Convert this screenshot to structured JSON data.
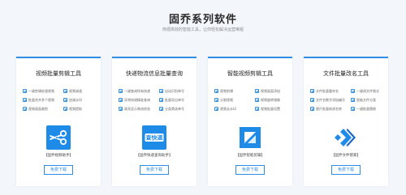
{
  "header": {
    "title": "固乔系列软件",
    "subtitle": "简便高效的智能工具，让你轻松解决运营难题"
  },
  "cards": [
    {
      "title": "视频批量剪辑工具",
      "features": [
        "一键剪辑处理视频",
        "视频调速",
        "批量合并多个视频",
        "加减水印",
        "视频画面裁剪",
        "视频提取"
      ],
      "caption": "【固乔视频助手】",
      "button": "免费下载",
      "icon": "scissors-icon"
    },
    {
      "title": "快递物流信息批量查询",
      "features": [
        "一键查询所有快递",
        "自动识别单号",
        "异常快递精准查询",
        "批量导出单号",
        "高亮显示物流状态",
        "分类筛选单号"
      ],
      "caption": "【固乔快递查询助手】",
      "button": "免费下载",
      "icon": "express-query-icon"
    },
    {
      "title": "智能视频剪辑工具",
      "features": [
        "视频剪辑",
        "视频画面添加",
        "分割视频",
        "视频旋转镜像",
        "视频去水印",
        "视频批量设置"
      ],
      "caption": "【固乔智能剪辑】",
      "button": "免费下载",
      "icon": "smart-edit-icon"
    },
    {
      "title": "文件批量改名工具",
      "features": [
        "文件批量重命名",
        "一键改文件格式",
        "文件名数字添加编号",
        "智能文件分类",
        "图片批量修改名称",
        "一键批量替换"
      ],
      "caption": "【固乔文件管家】",
      "button": "免费下载",
      "icon": "file-manager-icon"
    }
  ]
}
